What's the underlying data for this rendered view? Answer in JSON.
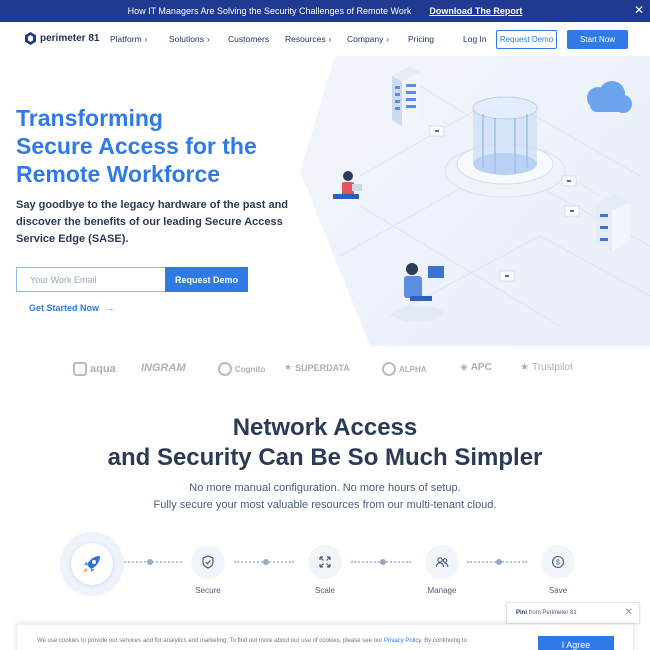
{
  "banner": {
    "text": "How IT Managers Are Solving the Security Challenges of Remote Work",
    "link": "Download The Report",
    "close": "✕"
  },
  "nav": {
    "brand": "perimeter 81",
    "items": [
      {
        "label": "Platform",
        "chevron": true
      },
      {
        "label": "Solutions",
        "chevron": true
      },
      {
        "label": "Customers",
        "chevron": false
      },
      {
        "label": "Resources",
        "chevron": true
      },
      {
        "label": "Company",
        "chevron": true
      },
      {
        "label": "Pricing",
        "chevron": false
      }
    ],
    "login": "Log In",
    "request_demo": "Request Demo",
    "start_now": "Start Now"
  },
  "hero": {
    "title_lines": [
      "Transforming",
      "Secure Access for the",
      "Remote Workforce"
    ],
    "subtitle": "Say goodbye to the legacy hardware of the past and discover the benefits of our leading Secure Access Service Edge (SASE).",
    "email_placeholder": "Your Work Email",
    "cta": "Request Demo",
    "get_started": "Get Started Now",
    "arrow": "→"
  },
  "logos": [
    "aqua",
    "INGRAM",
    "Cognito",
    "SUPERDATA",
    "ALPHA",
    "APC",
    "Trustpilot"
  ],
  "section": {
    "title_line1": "Network Access",
    "title_line2": "and Security Can Be So Much Simpler",
    "sub_line1": "No more manual configuration. No more hours of setup.",
    "sub_line2": "Fully secure your most valuable resources from our multi-tenant cloud."
  },
  "steps": [
    {
      "label": "Secure",
      "icon": "shield-icon"
    },
    {
      "label": "Scale",
      "icon": "scale-icon"
    },
    {
      "label": "Manage",
      "icon": "users-icon"
    },
    {
      "label": "Save",
      "icon": "dollar-icon"
    }
  ],
  "chat": {
    "name": "Pini",
    "from": "from Perimeter 81",
    "close": "✕"
  },
  "cookie": {
    "text": "We use cookies to provide our services and for analytics and marketing. To find out more about our use of cookies, please see our",
    "policy": "Privacy Policy",
    "text_after": ". By continuing to",
    "agree": "I Agree"
  },
  "colors": {
    "brand_blue": "#2f7ae5",
    "banner_navy": "#1f3a8f",
    "heading_dark": "#2b3a55"
  }
}
